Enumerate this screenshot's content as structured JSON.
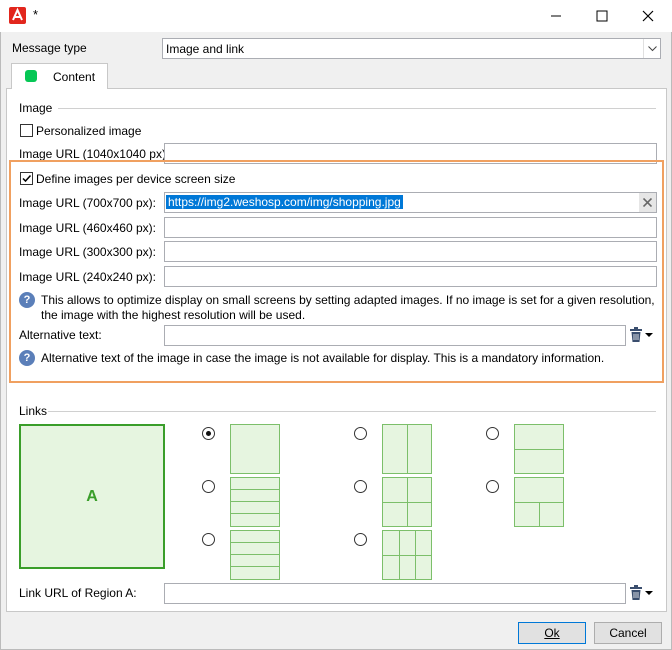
{
  "window": {
    "title": "*"
  },
  "message_type": {
    "label": "Message type",
    "value": "Image and link"
  },
  "tab": {
    "label": "Content"
  },
  "image_section": {
    "title": "Image",
    "personalized_label": "Personalized image",
    "url_1040_label": "Image URL (1040x1040 px):",
    "define_per_device_label": "Define images per device screen size",
    "url_700_label": "Image URL (700x700 px):",
    "url_700_value": "https://img2.weshosp.com/img/shopping.jpg",
    "url_460_label": "Image URL (460x460 px):",
    "url_300_label": "Image URL (300x300 px):",
    "url_240_label": "Image URL (240x240 px):",
    "help_optimize": "This allows to optimize display on small screens by setting adapted images. If no image is set for a given resolution, the image with the highest resolution will be used.",
    "alt_text_label": "Alternative text:",
    "help_alt": "Alternative text of the image in case the image is not available for display. This is a mandatory information."
  },
  "links_section": {
    "title": "Links",
    "region_label": "A",
    "link_url_label": "Link URL of Region A:"
  },
  "buttons": {
    "ok": "Ok",
    "cancel": "Cancel"
  },
  "colors": {
    "accent_orange": "#f0a060",
    "layout_green": "#7cbf6a",
    "layout_fill": "#e6f5e0"
  }
}
